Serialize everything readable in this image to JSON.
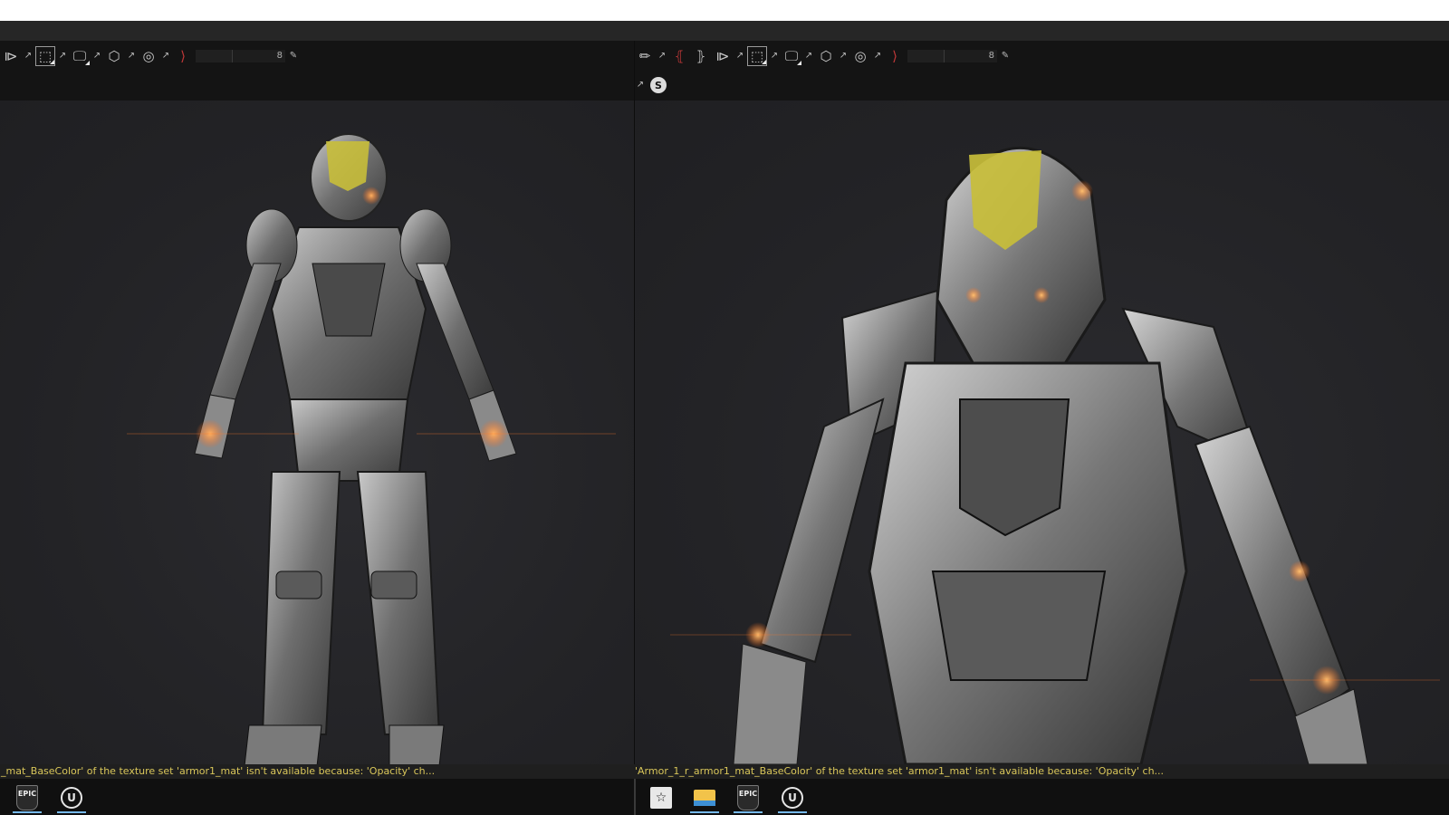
{
  "left_pane": {
    "toolbar": {
      "icons": [
        "mirror-icon",
        "popout-icon",
        "cube-view-icon",
        "popout-icon",
        "display-icon",
        "popout-icon",
        "wire-cube-icon",
        "popout-icon",
        "camera-icon",
        "popout-icon",
        "red-mirror-icon"
      ],
      "brush_value": "8"
    },
    "status_text": "_mat_BaseColor' of the texture set 'armor1_mat' isn't available because: 'Opacity' ch..."
  },
  "right_pane": {
    "toolbar": {
      "icons": [
        "paint-brush-icon",
        "popout-icon",
        "symmetry-icon",
        "symmetry-x-icon",
        "mirror-icon",
        "popout-icon",
        "cube-view-icon",
        "popout-icon",
        "display-icon",
        "popout-icon",
        "wire-cube-icon",
        "popout-icon",
        "camera-icon",
        "popout-icon",
        "red-mirror-icon"
      ],
      "brush_value": "8",
      "second_row_icons": [
        "popout-icon",
        "substance-icon"
      ]
    },
    "status_text": "'Armor_1_r_armor1_mat_BaseColor' of the texture set 'armor1_mat' isn't available because: 'Opacity' ch..."
  },
  "taskbar": {
    "epic_label": "EPIC",
    "ue_label": "U"
  },
  "colors": {
    "status_text": "#d9c65a",
    "viewport_bg": "#232326",
    "armor_highlight": "#cfc23a",
    "glow": "#ff7a2a",
    "taskbar_active": "#76b9ed"
  }
}
